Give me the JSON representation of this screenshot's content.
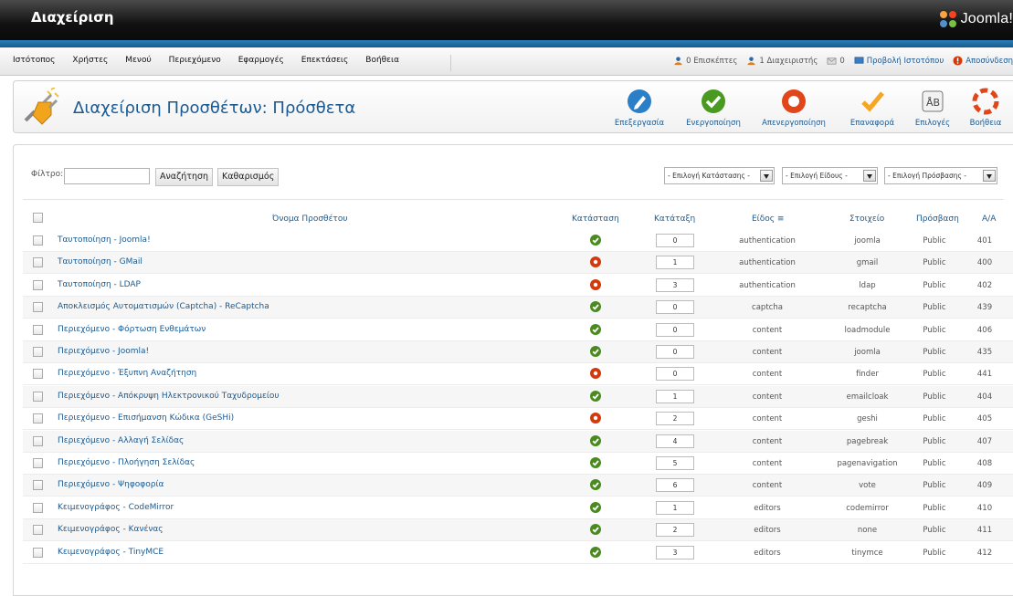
{
  "header": {
    "title": "Διαχείριση",
    "brand": "Joomla!"
  },
  "menu": [
    "Ιστότοπος",
    "Χρήστες",
    "Μενού",
    "Περιεχόμενο",
    "Εφαρμογές",
    "Επεκτάσεις",
    "Βοήθεια"
  ],
  "status": {
    "visitors": "0 Επισκέπτες",
    "admins": "1 Διαχειριστής",
    "messages": "0",
    "view_site": "Προβολή Ιστοτόπου",
    "logout": "Αποσύνδεση"
  },
  "page_title": "Διαχείριση Προσθέτων: Πρόσθετα",
  "toolbar": {
    "edit": "Επεξεργασία",
    "enable": "Ενεργοποίηση",
    "disable": "Απενεργοποίηση",
    "checkin": "Επαναφορά",
    "options": "Επιλογές",
    "help": "Βοήθεια"
  },
  "filter": {
    "label": "Φίλτρο:",
    "value": "",
    "search_button": "Αναζήτηση",
    "clear_button": "Καθαρισμός",
    "state_select": "- Επιλογή Κατάστασης -",
    "type_select": "- Επιλογή Είδους -",
    "access_select": "- Επιλογή Πρόσβασης -"
  },
  "columns": {
    "name": "Όνομα Προσθέτου",
    "status": "Κατάσταση",
    "ordering": "Κατάταξη",
    "type": "Είδος",
    "element": "Στοιχείο",
    "access": "Πρόσβαση",
    "id": "Α/Α"
  },
  "colors": {
    "enabled": "#4a8a1e",
    "disabled": "#d23a0e",
    "link": "#1b5a91"
  },
  "rows": [
    {
      "name": "Ταυτοποίηση - Joomla!",
      "enabled": true,
      "order": "0",
      "type": "authentication",
      "element": "joomla",
      "access": "Public",
      "id": "401"
    },
    {
      "name": "Ταυτοποίηση - GMail",
      "enabled": false,
      "order": "1",
      "type": "authentication",
      "element": "gmail",
      "access": "Public",
      "id": "400"
    },
    {
      "name": "Ταυτοποίηση - LDAP",
      "enabled": false,
      "order": "3",
      "type": "authentication",
      "element": "ldap",
      "access": "Public",
      "id": "402"
    },
    {
      "name": "Αποκλεισμός Αυτοματισμών (Captcha) - ReCaptcha",
      "enabled": true,
      "order": "0",
      "type": "captcha",
      "element": "recaptcha",
      "access": "Public",
      "id": "439"
    },
    {
      "name": "Περιεχόμενο - Φόρτωση Ενθεμάτων",
      "enabled": true,
      "order": "0",
      "type": "content",
      "element": "loadmodule",
      "access": "Public",
      "id": "406"
    },
    {
      "name": "Περιεχόμενο - Joomla!",
      "enabled": true,
      "order": "0",
      "type": "content",
      "element": "joomla",
      "access": "Public",
      "id": "435"
    },
    {
      "name": "Περιεχόμενο - Έξυπνη Αναζήτηση",
      "enabled": false,
      "order": "0",
      "type": "content",
      "element": "finder",
      "access": "Public",
      "id": "441"
    },
    {
      "name": "Περιεχόμενο - Απόκρυψη Ηλεκτρονικού Ταχυδρομείου",
      "enabled": true,
      "order": "1",
      "type": "content",
      "element": "emailcloak",
      "access": "Public",
      "id": "404"
    },
    {
      "name": "Περιεχόμενο - Επισήμανση Κώδικα (GeSHi)",
      "enabled": false,
      "order": "2",
      "type": "content",
      "element": "geshi",
      "access": "Public",
      "id": "405"
    },
    {
      "name": "Περιεχόμενο - Αλλαγή Σελίδας",
      "enabled": true,
      "order": "4",
      "type": "content",
      "element": "pagebreak",
      "access": "Public",
      "id": "407"
    },
    {
      "name": "Περιεχόμενο - Πλοήγηση Σελίδας",
      "enabled": true,
      "order": "5",
      "type": "content",
      "element": "pagenavigation",
      "access": "Public",
      "id": "408"
    },
    {
      "name": "Περιεχόμενο - Ψηφοφορία",
      "enabled": true,
      "order": "6",
      "type": "content",
      "element": "vote",
      "access": "Public",
      "id": "409"
    },
    {
      "name": "Κειμενογράφος - CodeMirror",
      "enabled": true,
      "order": "1",
      "type": "editors",
      "element": "codemirror",
      "access": "Public",
      "id": "410"
    },
    {
      "name": "Κειμενογράφος - Κανένας",
      "enabled": true,
      "order": "2",
      "type": "editors",
      "element": "none",
      "access": "Public",
      "id": "411"
    },
    {
      "name": "Κειμενογράφος - TinyMCE",
      "enabled": true,
      "order": "3",
      "type": "editors",
      "element": "tinymce",
      "access": "Public",
      "id": "412"
    }
  ]
}
